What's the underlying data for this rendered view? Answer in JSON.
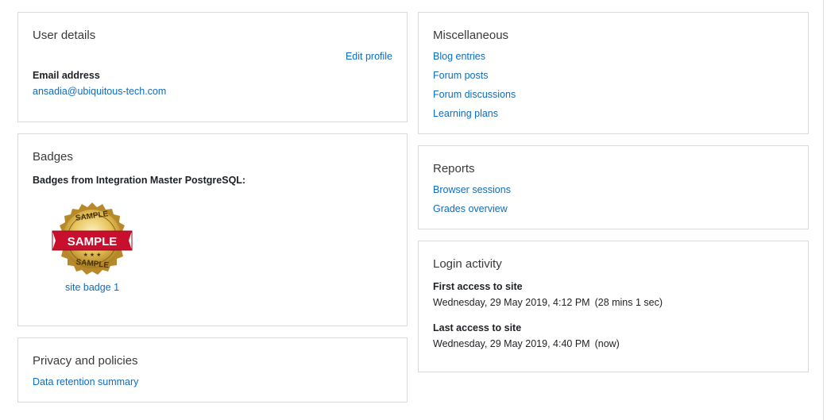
{
  "user_details": {
    "title": "User details",
    "edit_profile": "Edit profile",
    "email_label": "Email address",
    "email_value": "ansadia@ubiquitous-tech.com"
  },
  "badges": {
    "title": "Badges",
    "from_label": "Badges from Integration Master PostgreSQL:",
    "items": [
      {
        "name": "site badge 1",
        "image_text_top": "SAMPLE",
        "image_text_banner": "SAMPLE",
        "image_text_bottom": "SAMPLE"
      }
    ]
  },
  "privacy": {
    "title": "Privacy and policies",
    "links": [
      "Data retention summary"
    ]
  },
  "miscellaneous": {
    "title": "Miscellaneous",
    "links": [
      "Blog entries",
      "Forum posts",
      "Forum discussions",
      "Learning plans"
    ]
  },
  "reports": {
    "title": "Reports",
    "links": [
      "Browser sessions",
      "Grades overview"
    ]
  },
  "login_activity": {
    "title": "Login activity",
    "first_access_label": "First access to site",
    "first_access_value": "Wednesday, 29 May 2019, 4:12 PM",
    "first_access_duration": "(28 mins 1 sec)",
    "last_access_label": "Last access to site",
    "last_access_value": "Wednesday, 29 May 2019, 4:40 PM",
    "last_access_duration": "(now)"
  },
  "colors": {
    "link": "#0f6cbf",
    "border": "#d9d9d9",
    "badge_gold": "#e0b84a",
    "badge_ribbon": "#c8102e"
  }
}
